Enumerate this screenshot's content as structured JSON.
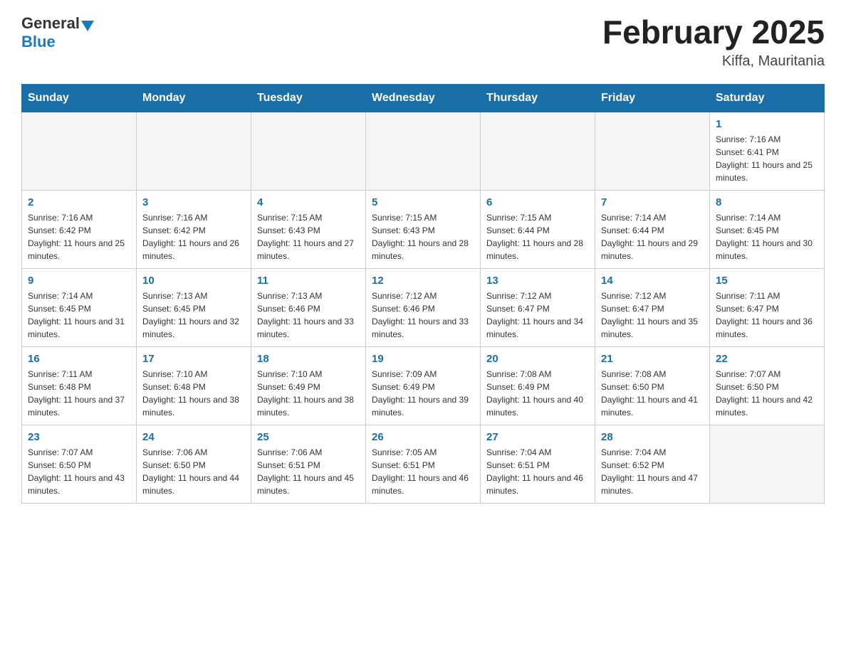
{
  "header": {
    "logo_general": "General",
    "logo_blue": "Blue",
    "month_title": "February 2025",
    "location": "Kiffa, Mauritania"
  },
  "days_of_week": [
    "Sunday",
    "Monday",
    "Tuesday",
    "Wednesday",
    "Thursday",
    "Friday",
    "Saturday"
  ],
  "weeks": [
    {
      "cells": [
        {
          "empty": true
        },
        {
          "empty": true
        },
        {
          "empty": true
        },
        {
          "empty": true
        },
        {
          "empty": true
        },
        {
          "empty": true
        },
        {
          "day": "1",
          "sunrise": "7:16 AM",
          "sunset": "6:41 PM",
          "daylight": "11 hours and 25 minutes."
        }
      ]
    },
    {
      "cells": [
        {
          "day": "2",
          "sunrise": "7:16 AM",
          "sunset": "6:42 PM",
          "daylight": "11 hours and 25 minutes."
        },
        {
          "day": "3",
          "sunrise": "7:16 AM",
          "sunset": "6:42 PM",
          "daylight": "11 hours and 26 minutes."
        },
        {
          "day": "4",
          "sunrise": "7:15 AM",
          "sunset": "6:43 PM",
          "daylight": "11 hours and 27 minutes."
        },
        {
          "day": "5",
          "sunrise": "7:15 AM",
          "sunset": "6:43 PM",
          "daylight": "11 hours and 28 minutes."
        },
        {
          "day": "6",
          "sunrise": "7:15 AM",
          "sunset": "6:44 PM",
          "daylight": "11 hours and 28 minutes."
        },
        {
          "day": "7",
          "sunrise": "7:14 AM",
          "sunset": "6:44 PM",
          "daylight": "11 hours and 29 minutes."
        },
        {
          "day": "8",
          "sunrise": "7:14 AM",
          "sunset": "6:45 PM",
          "daylight": "11 hours and 30 minutes."
        }
      ]
    },
    {
      "cells": [
        {
          "day": "9",
          "sunrise": "7:14 AM",
          "sunset": "6:45 PM",
          "daylight": "11 hours and 31 minutes."
        },
        {
          "day": "10",
          "sunrise": "7:13 AM",
          "sunset": "6:45 PM",
          "daylight": "11 hours and 32 minutes."
        },
        {
          "day": "11",
          "sunrise": "7:13 AM",
          "sunset": "6:46 PM",
          "daylight": "11 hours and 33 minutes."
        },
        {
          "day": "12",
          "sunrise": "7:12 AM",
          "sunset": "6:46 PM",
          "daylight": "11 hours and 33 minutes."
        },
        {
          "day": "13",
          "sunrise": "7:12 AM",
          "sunset": "6:47 PM",
          "daylight": "11 hours and 34 minutes."
        },
        {
          "day": "14",
          "sunrise": "7:12 AM",
          "sunset": "6:47 PM",
          "daylight": "11 hours and 35 minutes."
        },
        {
          "day": "15",
          "sunrise": "7:11 AM",
          "sunset": "6:47 PM",
          "daylight": "11 hours and 36 minutes."
        }
      ]
    },
    {
      "cells": [
        {
          "day": "16",
          "sunrise": "7:11 AM",
          "sunset": "6:48 PM",
          "daylight": "11 hours and 37 minutes."
        },
        {
          "day": "17",
          "sunrise": "7:10 AM",
          "sunset": "6:48 PM",
          "daylight": "11 hours and 38 minutes."
        },
        {
          "day": "18",
          "sunrise": "7:10 AM",
          "sunset": "6:49 PM",
          "daylight": "11 hours and 38 minutes."
        },
        {
          "day": "19",
          "sunrise": "7:09 AM",
          "sunset": "6:49 PM",
          "daylight": "11 hours and 39 minutes."
        },
        {
          "day": "20",
          "sunrise": "7:08 AM",
          "sunset": "6:49 PM",
          "daylight": "11 hours and 40 minutes."
        },
        {
          "day": "21",
          "sunrise": "7:08 AM",
          "sunset": "6:50 PM",
          "daylight": "11 hours and 41 minutes."
        },
        {
          "day": "22",
          "sunrise": "7:07 AM",
          "sunset": "6:50 PM",
          "daylight": "11 hours and 42 minutes."
        }
      ]
    },
    {
      "cells": [
        {
          "day": "23",
          "sunrise": "7:07 AM",
          "sunset": "6:50 PM",
          "daylight": "11 hours and 43 minutes."
        },
        {
          "day": "24",
          "sunrise": "7:06 AM",
          "sunset": "6:50 PM",
          "daylight": "11 hours and 44 minutes."
        },
        {
          "day": "25",
          "sunrise": "7:06 AM",
          "sunset": "6:51 PM",
          "daylight": "11 hours and 45 minutes."
        },
        {
          "day": "26",
          "sunrise": "7:05 AM",
          "sunset": "6:51 PM",
          "daylight": "11 hours and 46 minutes."
        },
        {
          "day": "27",
          "sunrise": "7:04 AM",
          "sunset": "6:51 PM",
          "daylight": "11 hours and 46 minutes."
        },
        {
          "day": "28",
          "sunrise": "7:04 AM",
          "sunset": "6:52 PM",
          "daylight": "11 hours and 47 minutes."
        },
        {
          "empty": true
        }
      ]
    }
  ],
  "labels": {
    "sunrise_prefix": "Sunrise: ",
    "sunset_prefix": "Sunset: ",
    "daylight_prefix": "Daylight: "
  }
}
